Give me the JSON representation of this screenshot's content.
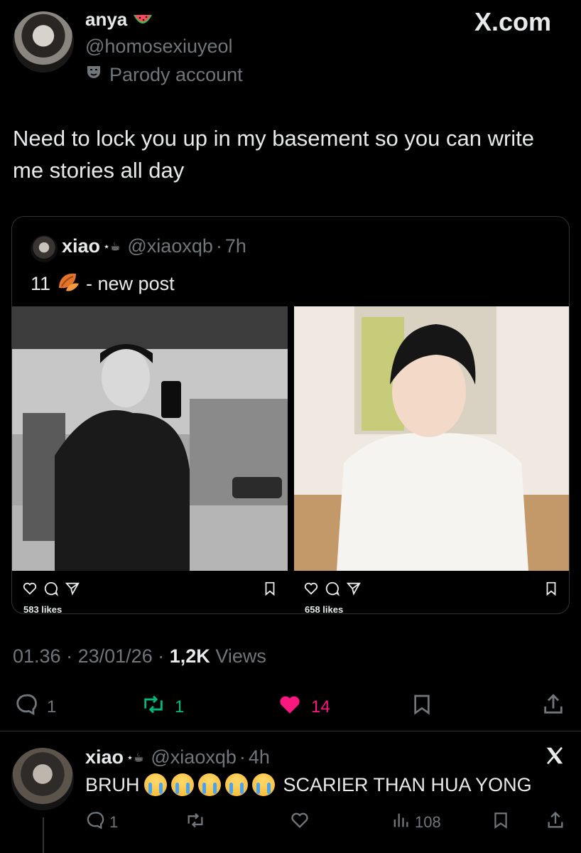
{
  "header": {
    "display_name": "anya",
    "name_emoji": "watermelon-icon",
    "handle": "@homosexiuyeol",
    "parody_label": "Parody account",
    "brand": "X.com"
  },
  "tweet": {
    "text": "Need to lock you up in my basement so you can write me stories all day"
  },
  "quote": {
    "display_name": "xiao",
    "name_suffix": "⋆☕",
    "handle": "@xiaoxqb",
    "separator": "·",
    "time": "7h",
    "text_prefix": "11",
    "text_emoji": "fallen-leaf-icon",
    "text_suffix": "- new post",
    "photos": [
      {
        "likes": "583 likes",
        "alt": "gym-mirror-selfie"
      },
      {
        "likes": "658 likes",
        "alt": "portrait-white-shirt"
      }
    ]
  },
  "meta": {
    "time": "01.36",
    "sep1": "·",
    "date": "23/01/26",
    "sep2": "·",
    "views_count": "1,2K",
    "views_label": "Views"
  },
  "engagement": {
    "replies": "1",
    "reposts": "1",
    "likes": "14",
    "colors": {
      "repost": "#00ba7c",
      "like": "#f91880"
    }
  },
  "reply": {
    "display_name": "xiao",
    "name_suffix": "⋆☕",
    "handle": "@xiaoxqb",
    "separator": "·",
    "time": "4h",
    "text_prefix": "BRUH",
    "emoji_count_icon": "loudly-crying-face-icon",
    "text_suffix": "SCARIER THAN HUA YONG",
    "replies": "1",
    "views": "108"
  }
}
